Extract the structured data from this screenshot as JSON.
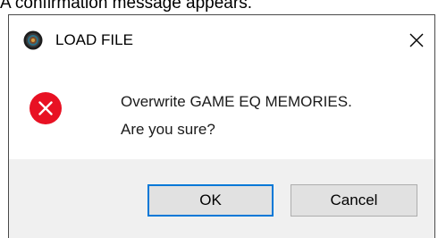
{
  "caption": "A confirmation message appears.",
  "dialog": {
    "title": "LOAD FILE",
    "app_icon": "speaker-disc-icon",
    "close_icon": "close-icon",
    "message_icon": "error-icon",
    "message_line1": "Overwrite GAME EQ MEMORIES.",
    "message_line2": "Are you sure?",
    "ok_label": "OK",
    "cancel_label": "Cancel",
    "accent_color": "#0078d7",
    "error_color": "#e81123"
  }
}
